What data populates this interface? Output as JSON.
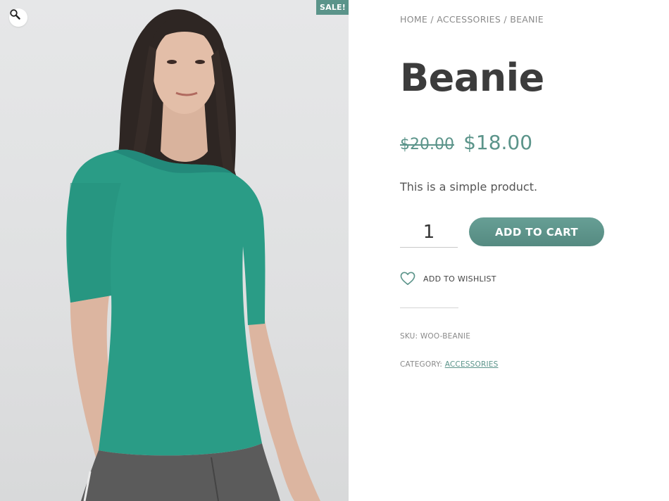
{
  "gallery": {
    "badge": "SALE!",
    "zoom_icon": "magnifier-icon",
    "image_subject": "woman-in-teal-tshirt"
  },
  "breadcrumb": {
    "items": [
      "HOME",
      "ACCESSORIES",
      "BEANIE"
    ],
    "separator": "/"
  },
  "product": {
    "title": "Beanie",
    "price_old": "$20.00",
    "price_new": "$18.00",
    "short_description": "This is a simple product.",
    "quantity": "1",
    "add_to_cart_label": "ADD TO CART",
    "wishlist_label": "ADD TO WISHLIST",
    "wishlist_icon": "heart-outline-icon",
    "sku_label": "SKU:",
    "sku_value": "WOO-BEANIE",
    "category_label": "CATEGORY:",
    "category_value": "ACCESSORIES"
  },
  "colors": {
    "accent": "#5b948a",
    "title": "#3c3c3c",
    "muted": "#8a8a8a"
  }
}
